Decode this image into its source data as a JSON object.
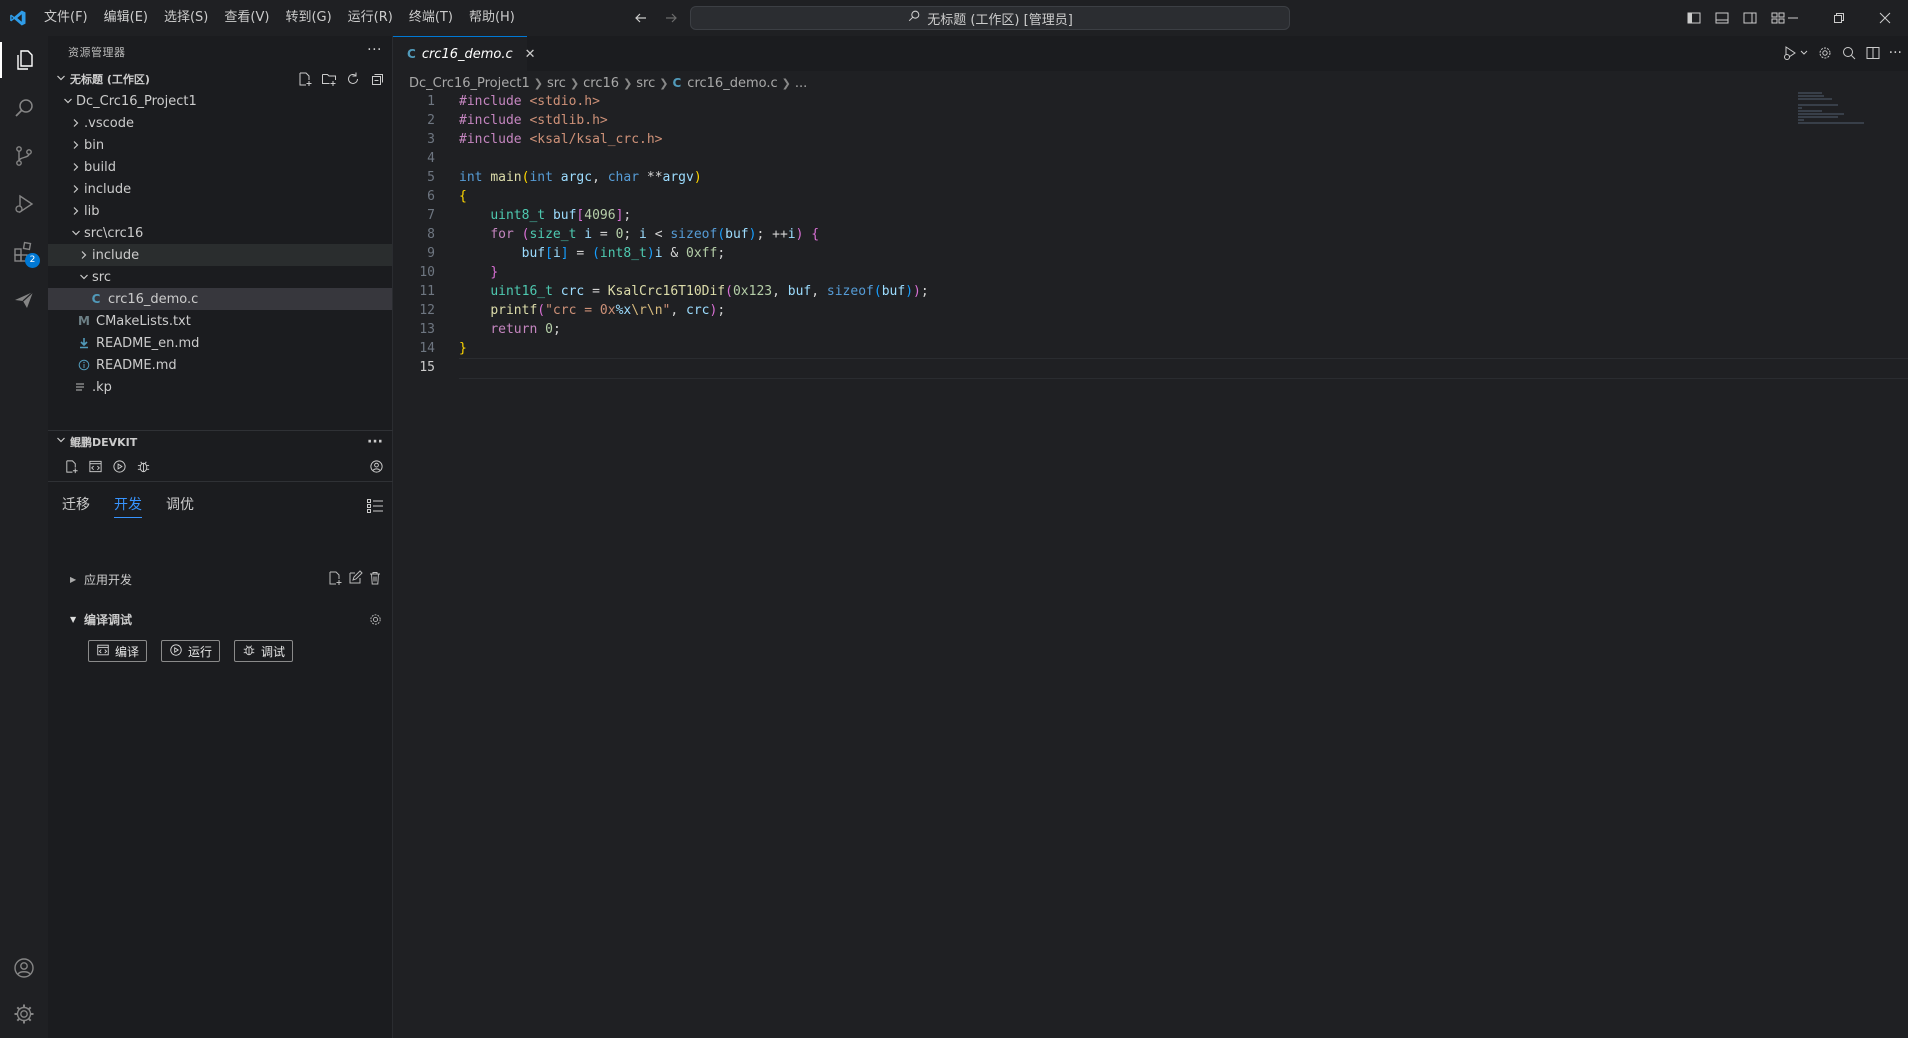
{
  "menu": [
    "文件(F)",
    "编辑(E)",
    "选择(S)",
    "查看(V)",
    "转到(G)",
    "运行(R)",
    "终端(T)",
    "帮助(H)"
  ],
  "command_center": "无标题 (工作区) [管理员]",
  "explorer": {
    "title": "资源管理器",
    "workspace": "无标题 (工作区)",
    "project": "Dc_Crc16_Project1",
    "items": [
      ".vscode",
      "bin",
      "build",
      "include",
      "lib",
      "src\\crc16",
      "include",
      "src",
      "crc16_demo.c",
      "CMakeLists.txt",
      "README_en.md",
      "README.md",
      ".kp"
    ]
  },
  "activity_badge": "2",
  "devkit": {
    "title": "鲲鹏DEVKIT",
    "tabs": [
      "迁移",
      "开发",
      "调优"
    ],
    "app_dev": "应用开发",
    "build_debug": "编译调试",
    "buttons": [
      "编译",
      "运行",
      "调试"
    ]
  },
  "editor": {
    "tab_label": "crc16_demo.c",
    "breadcrumb": [
      "Dc_Crc16_Project1",
      "src",
      "crc16",
      "src",
      "crc16_demo.c",
      "..."
    ],
    "line_numbers": [
      "1",
      "2",
      "3",
      "4",
      "5",
      "6",
      "7",
      "8",
      "9",
      "10",
      "11",
      "12",
      "13",
      "14",
      "15"
    ],
    "current_line": 15,
    "code": {
      "inc_kw": "#include",
      "inc1": "<stdio.h>",
      "inc2": "<stdlib.h>",
      "inc3": "<ksal/ksal_crc.h>",
      "int": "int",
      "main": "main",
      "char": "char",
      "argc": "argc",
      "argv": "argv",
      "uint8_t": "uint8_t",
      "buf": "buf",
      "n4096": "4096",
      "for": "for",
      "size_t": "size_t",
      "i": "i",
      "zero": "0",
      "sizeof": "sizeof",
      "int8_t": "int8_t",
      "hexff": "0xff",
      "uint16_t": "uint16_t",
      "crc": "crc",
      "fn_crc": "KsalCrc16T10Dif",
      "hex123": "0x123",
      "printf": "printf",
      "fmt_a": "\"crc = 0x",
      "fmt_b": "%x",
      "fmt_c": "\\r\\n",
      "fmt_d": "\"",
      "return": "return"
    }
  },
  "colors": {
    "accent": "#0078d4",
    "active_tab_text": "#3794ff",
    "c_file_icon": "#519aba",
    "markdown_icon": "#519aba",
    "cmake_icon": "#6d8086"
  }
}
